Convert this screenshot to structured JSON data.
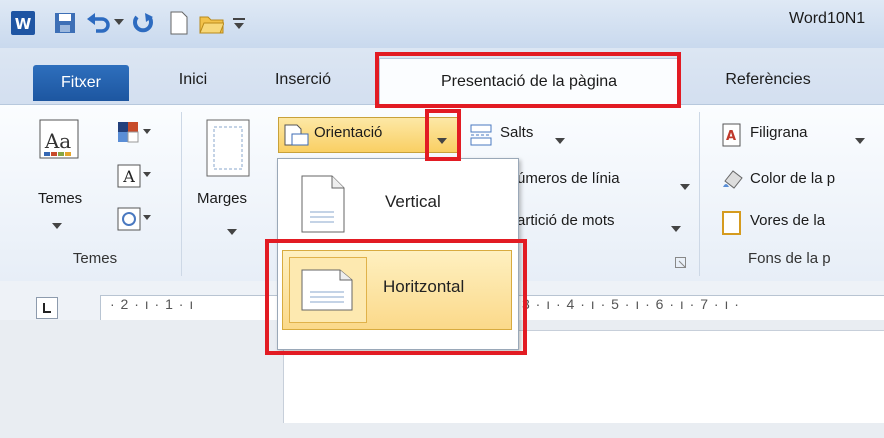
{
  "window": {
    "title": "Word10N1"
  },
  "tabs": [
    {
      "label": "Fitxer"
    },
    {
      "label": "Inici"
    },
    {
      "label": "Inserció"
    },
    {
      "label": "Presentació de la pàgina"
    },
    {
      "label": "Referències"
    }
  ],
  "ribbon": {
    "themes_group": {
      "label": "Temes",
      "button_label": "Temes"
    },
    "page_setup": {
      "margins_label": "Marges",
      "orientation_label": "Orientació",
      "breaks_label": "Salts",
      "line_numbers_label": "úmeros de línia",
      "hyphenation_label": "artició de mots"
    },
    "page_background": {
      "label": "Fons de la p",
      "watermark_label": "Filigrana",
      "page_color_label": "Color de la p",
      "page_borders_label": "Vores de la"
    }
  },
  "orientation_menu": {
    "items": [
      {
        "label": "Vertical"
      },
      {
        "label": "Horitzontal"
      }
    ],
    "selected": "Horitzontal"
  },
  "ruler": {
    "text": "· 2 · ı · 1 · ı",
    "text_right": "3 · ı · 4 · ı · 5 · ı · 6 · ı · 7 · ı ·"
  },
  "colors": {
    "accent": "#1d56a0",
    "highlight": "#e21b23",
    "menu_hover": "#fbe29a"
  }
}
